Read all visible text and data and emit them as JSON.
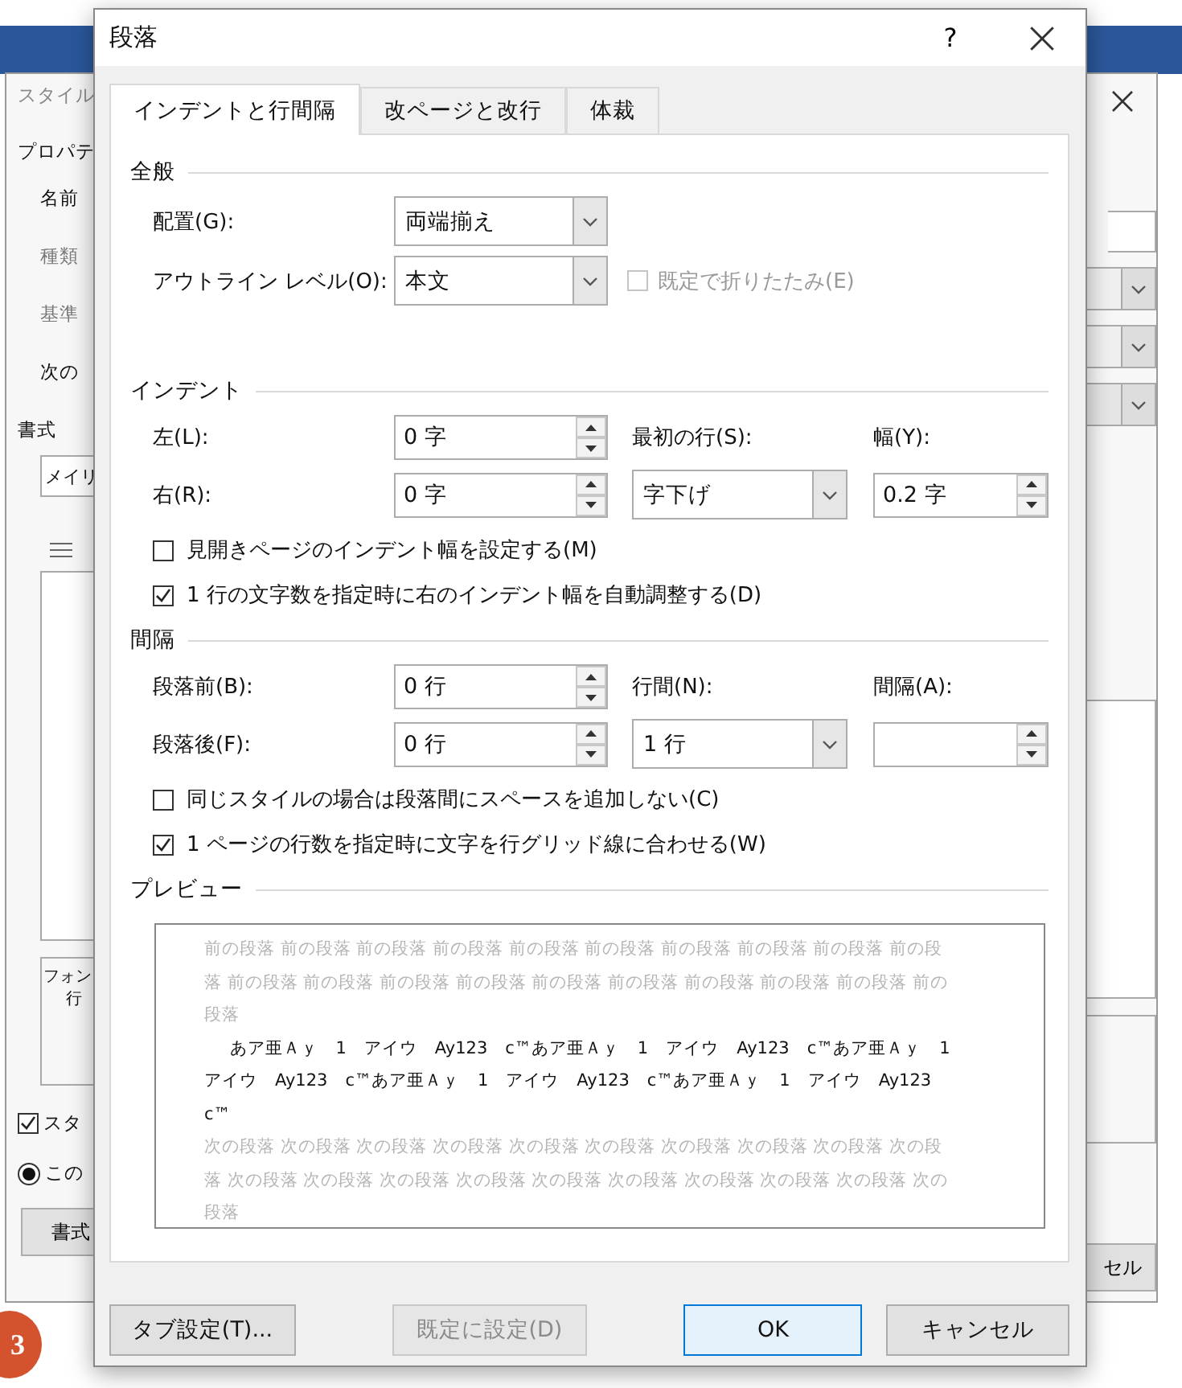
{
  "background": {
    "step_number": "3"
  },
  "style_dialog": {
    "title": "スタイル",
    "section": "プロパテ",
    "fields": [
      {
        "label": "名前",
        "disabled": false,
        "kind": "input"
      },
      {
        "label": "種類",
        "disabled": true,
        "kind": "dropdown"
      },
      {
        "label": "基準",
        "disabled": true,
        "kind": "dropdown"
      },
      {
        "label": "次の",
        "disabled": false,
        "kind": "dropdown"
      }
    ],
    "format_heading": "書式",
    "font_dropdown": "メイリ",
    "description": [
      "フォン",
      "行"
    ],
    "checkbox": {
      "label": "スタ",
      "checked": true
    },
    "radio": {
      "label": "この",
      "selected": true
    },
    "buttons": [
      "書式",
      "セル"
    ]
  },
  "dialog": {
    "title": "段落",
    "help": "?",
    "tabs": [
      {
        "label": "インデントと行間隔",
        "selected": true
      },
      {
        "label": "改ページと改行",
        "selected": false
      },
      {
        "label": "体裁",
        "selected": false
      }
    ],
    "general": {
      "heading": "全般",
      "alignment": {
        "label": "配置(G):",
        "value": "両端揃え"
      },
      "outline_level": {
        "label": "アウトライン レベル(O):",
        "value": "本文"
      },
      "collapse": {
        "label": "既定で折りたたみ(E)",
        "checked": false,
        "disabled": true
      }
    },
    "indent": {
      "heading": "インデント",
      "left": {
        "label": "左(L):",
        "value": "0 字"
      },
      "right": {
        "label": "右(R):",
        "value": "0 字"
      },
      "first_line": {
        "label": "最初の行(S):",
        "value": "字下げ"
      },
      "by": {
        "label": "幅(Y):",
        "value": "0.2 字"
      },
      "options": [
        {
          "label": "見開きページのインデント幅を設定する(M)",
          "checked": false
        },
        {
          "label": "1 行の文字数を指定時に右のインデント幅を自動調整する(D)",
          "checked": true
        }
      ]
    },
    "spacing": {
      "heading": "間隔",
      "before": {
        "label": "段落前(B):",
        "value": "0 行"
      },
      "after": {
        "label": "段落後(F):",
        "value": "0 行"
      },
      "line_spacing": {
        "label": "行間(N):",
        "value": "1 行"
      },
      "at": {
        "label": "間隔(A):"
      },
      "options": [
        {
          "label": "同じスタイルの場合は段落間にスペースを追加しない(C)",
          "checked": false
        },
        {
          "label": "1 ページの行数を指定時に文字を行グリッド線に合わせる(W)",
          "checked": true
        }
      ]
    },
    "preview": {
      "heading": "プレビュー",
      "previous_text": "前の段落 前の段落 前の段落 前の段落 前の段落 前の段落 前の段落 前の段落 前の段落 前の段落 前の段落 前の段落 前の段落 前の段落 前の段落 前の段落 前の段落 前の段落 前の段落 前の段落",
      "sample_text": "あア亜Ａｙ　1　アイウ　Ay123　c™あア亜Ａｙ　1　アイウ　Ay123　c™あア亜Ａｙ　1　アイウ　Ay123　c™あア亜Ａｙ　1　アイウ　Ay123　c™あア亜Ａｙ　1　アイウ　Ay123　c™",
      "next_text": "次の段落 次の段落 次の段落 次の段落 次の段落 次の段落 次の段落 次の段落 次の段落 次の段落 次の段落 次の段落 次の段落 次の段落 次の段落 次の段落 次の段落 次の段落 次の段落 次の段落"
    },
    "buttons": [
      {
        "label": "タブ設定(T)...",
        "disabled": false,
        "default": false
      },
      {
        "label": "既定に設定(D)",
        "disabled": true,
        "default": false
      },
      {
        "label": "OK",
        "disabled": false,
        "default": true
      },
      {
        "label": "キャンセル",
        "disabled": false,
        "default": false
      }
    ]
  }
}
